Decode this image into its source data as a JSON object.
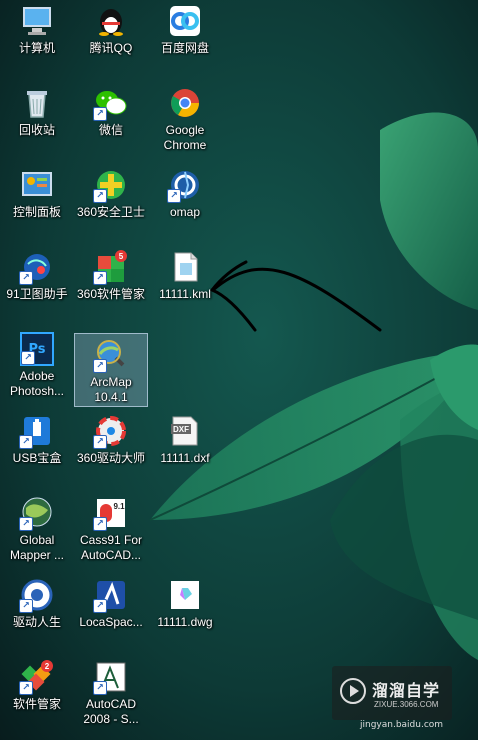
{
  "desktop": {
    "icons": [
      {
        "label": "计算机",
        "icon": "computer-icon"
      },
      {
        "label": "腾讯QQ",
        "icon": "qq-penguin-icon"
      },
      {
        "label": "百度网盘",
        "icon": "baidu-netdisk-icon"
      },
      {
        "label": "回收站",
        "icon": "recycle-bin-icon"
      },
      {
        "label": "微信",
        "icon": "wechat-icon"
      },
      {
        "label": "Google Chrome",
        "icon": "chrome-icon"
      },
      {
        "label": "控制面板",
        "icon": "control-panel-icon"
      },
      {
        "label": "360安全卫士",
        "icon": "360-safe-icon"
      },
      {
        "label": "omap",
        "icon": "omap-icon"
      },
      {
        "label": "91卫图助手",
        "icon": "91-map-icon"
      },
      {
        "label": "360软件管家",
        "icon": "360-software-manager-icon",
        "badge": "5"
      },
      {
        "label": "11111.kml",
        "icon": "kml-file-icon"
      },
      {
        "label": "Adobe Photosh...",
        "icon": "photoshop-icon",
        "glyph_text": "Ps"
      },
      {
        "label": "ArcMap 10.4.1",
        "icon": "arcmap-icon"
      },
      {
        "label": "USB宝盒",
        "icon": "usb-box-icon"
      },
      {
        "label": "360驱动大师",
        "icon": "360-driver-icon"
      },
      {
        "label": "11111.dxf",
        "icon": "dxf-file-icon",
        "glyph_text": "DXF"
      },
      {
        "label": "Global Mapper ...",
        "icon": "global-mapper-icon"
      },
      {
        "label": "Cass91 For AutoCAD...",
        "icon": "cass-icon",
        "glyph_text": "9.1"
      },
      {
        "label": "驱动人生",
        "icon": "driver-life-icon"
      },
      {
        "label": "LocaSpac...",
        "icon": "locaspace-icon"
      },
      {
        "label": "11111.dwg",
        "icon": "dwg-file-icon"
      },
      {
        "label": "软件管家",
        "icon": "software-manager-icon",
        "badge": "2"
      },
      {
        "label": "AutoCAD 2008 - S...",
        "icon": "autocad-icon"
      }
    ]
  },
  "watermark": {
    "title": "溜溜自学",
    "subtitle": "ZIXUE.3066.COM",
    "site": "jingyan.baidu.com"
  }
}
